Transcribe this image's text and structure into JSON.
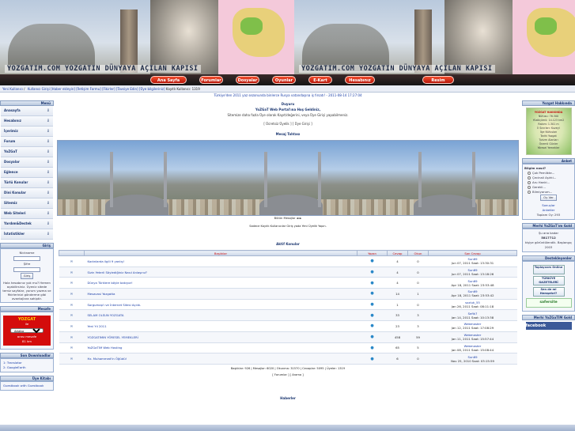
{
  "header": {
    "site_text_1": "YOZGATIM.COM YOZGATIN DÜNYAYA AÇILAN KAPISI",
    "site_text_2": "YOZGATIM.COM YOZGATIN DÜNYAYA AÇILAN KAPISI",
    "nav": [
      "Ana Sayfa",
      "Forumlar",
      "Dosyalar",
      "Oyunlar",
      "E-Kart",
      "Hesabınız",
      "Resim Galerisi"
    ]
  },
  "breadcrumb": [
    "Yeni Kullanıcı",
    "/",
    "Kullanıcı Girişi",
    "[Haber ekleyin]",
    "[İletişim Formu]",
    "[Fikirler]",
    "[Tavsiye Edin]",
    "[Üye bilgileriniz]",
    "Kayıtlı Kullanıcı: 1319"
  ],
  "left": {
    "menu_header": "Menü",
    "menu": [
      "Anasayfa",
      "Hesabınız",
      "İçerimiz",
      "Forum",
      "YoZGaT",
      "Dosyalar",
      "Eğlence",
      "Türlü Konular",
      "Dini Konular",
      "Sitemiz",
      "Web Siteleri",
      "Yardım&Destek",
      "İstatistikler"
    ],
    "login_header": "Giriş",
    "login": {
      "user_label": "Nickname",
      "pass_label": "Şifre",
      "button": "Giriş",
      "note": "Hala hesabınız yok mu? Hemen açabilirsiniz. Üyeniz sitede temiz sayfalar, yorum yazma ve fikirlerinizi gönderme gibi avantajlara sahiptir."
    },
    "search_header": "Mesafe",
    "search": {
      "city": "YOZGAT",
      "to": "ile",
      "select": "Antalya",
      "link1": "arası mesafe",
      "link2": "81 km"
    },
    "downloads_header": "Son Downloadlar",
    "downloads": [
      "1: Translator",
      "2: GoogleEarth"
    ],
    "guestbook_header": "Üye Kitabı",
    "guestbook_link": "Guestbook with Guestbook"
  },
  "main": {
    "ticker": "Türkiye'den 2011 yaz sezonunda binlerce Rusya vatandaşına iş fırsatı! - 2011-08-14 17:27:04",
    "welcome_title": "Duyuru",
    "welcome_line1": "YoZGaT Web Portal'ına Hoş Geldiniz,",
    "welcome_line2": "Sitemize daha fazla Üye olarak Kayıt/değerini, veya Üye Girişi yapabilmeniz.",
    "welcome_links": "[ Ücretsiz Üyelik ] [ Üye Girişi ]",
    "board_title": "Mesaj Tahtası",
    "pano_links": "Bütün Mesajlar  ◄ ►",
    "guest_note": "Sadece Kayıtlı Kullanıcılar Giriş yada Yeni Üyelik Yapın.",
    "topics_title": "Aktif Konular",
    "columns": [
      "Başlıklar",
      "Yazan",
      "Cevap",
      "Okun",
      "Son Cevap"
    ],
    "topics": [
      {
        "t": "Kadınlarda ilgili 9 yanlış!",
        "r": "4",
        "v": "0",
        "d": "Jun 07, 2011 Saat: 13:30:31",
        "u": "Sun69"
      },
      {
        "t": "Sizin Yeterli Söylediğiniz Nasıl Anlaşırız?",
        "r": "4",
        "v": "0",
        "d": "Jun 07, 2011 Saat: 13:18:26",
        "u": "Sun69"
      },
      {
        "t": "Dünya Türklere böyle bakıyor!",
        "r": "4",
        "v": "0",
        "d": "Apr 18, 2011 Saat: 23:53:48",
        "u": "Sun69"
      },
      {
        "t": "Mesavasi Yozgatta",
        "r": "14",
        "v": "1",
        "d": "Apr 18, 2011 Saat: 23:53:42",
        "u": "Sun69"
      },
      {
        "t": "Sorgumap'ı ve İnternet Sitesi Açıldı.",
        "r": "1",
        "v": "0",
        "d": "Jan 26, 2011 Saat: 08:11:18",
        "u": "sozluk_55"
      },
      {
        "t": "SELAM OLSUN YOZGATA",
        "r": "33",
        "v": "3",
        "d": "Jan 14, 2011 Saat: 10:13:38",
        "u": "Sefik7"
      },
      {
        "t": "Yeni Yıl 2011",
        "r": "23",
        "v": "3",
        "d": "Jan 12, 2011 Saat: 17:08:29",
        "u": "Webmaster"
      },
      {
        "t": "YOZGATIMIN YÖRESEL YEMEKLERİ",
        "r": "458",
        "v": "59",
        "d": "Jan 11, 2011 Saat: 15:57:44",
        "u": "Webmaster"
      },
      {
        "t": "YoZGaTIM Web Hosting",
        "r": "65",
        "v": "5",
        "d": "Jan 08, 2011 Saat: 15:08:44",
        "u": "Webmaster"
      },
      {
        "t": "Hz. Muhammed'in Öğüdü!",
        "r": "6",
        "v": "0",
        "d": "Nov 25, 2010 Saat: 03:15:59",
        "u": "Sun69"
      }
    ],
    "stats": "Başlıklar: 926 | Mesajlar: 6020 | Okunma: 31570 | Cevaplar: 5095 | Üyeler: 1319",
    "stats_links": "[ Forumlar ]   [ Arama ]",
    "news_title": "Haberler"
  },
  "right": {
    "yozgat_header": "Yozgat Hakkında",
    "yozgat_title": "YOZGAT HAKKINDA",
    "yozgat_lines": [
      "Nüfusu: 76.300",
      "Yüzölçümü: 14.123 km2",
      "Rakım: 1.301 m",
      "İl Sınırları: Kuzeyi",
      "İlçe Nüfusları",
      "Tarihi Yozgat",
      "Turizm Alanları",
      "Önemli Günler",
      "Yöresel Yemekler"
    ],
    "poll_header": "Anket",
    "poll_question": "Bilgim nasıl?",
    "poll_options": [
      "Çok Pemlikte...",
      "Çecinali Aşirki...",
      "Aru Hanki...",
      "Gerekli...",
      "Bilmiyorum..."
    ],
    "poll_button": "Oy Ver",
    "poll_links": [
      "Sonuçlar",
      "Anketler"
    ],
    "poll_votes": "Toplam Oy: 293",
    "stats_header": "Merhi YoZGaT'ım Gold",
    "stats_lines": [
      "Şu ana kadar",
      "5817712",
      "kişiye görüntülendik. Başlangıç",
      "2003"
    ],
    "ads_header": "Destekleyenler",
    "badge1": "Toplayıcım Online",
    "badge2": "TÜRKİYE GAZETELERİ",
    "badge3": "Sen de mi Hemşehri?",
    "badge4": "safersite",
    "fb_header": "Merhi YoZGaTIM Gold",
    "fb": "facebook"
  }
}
